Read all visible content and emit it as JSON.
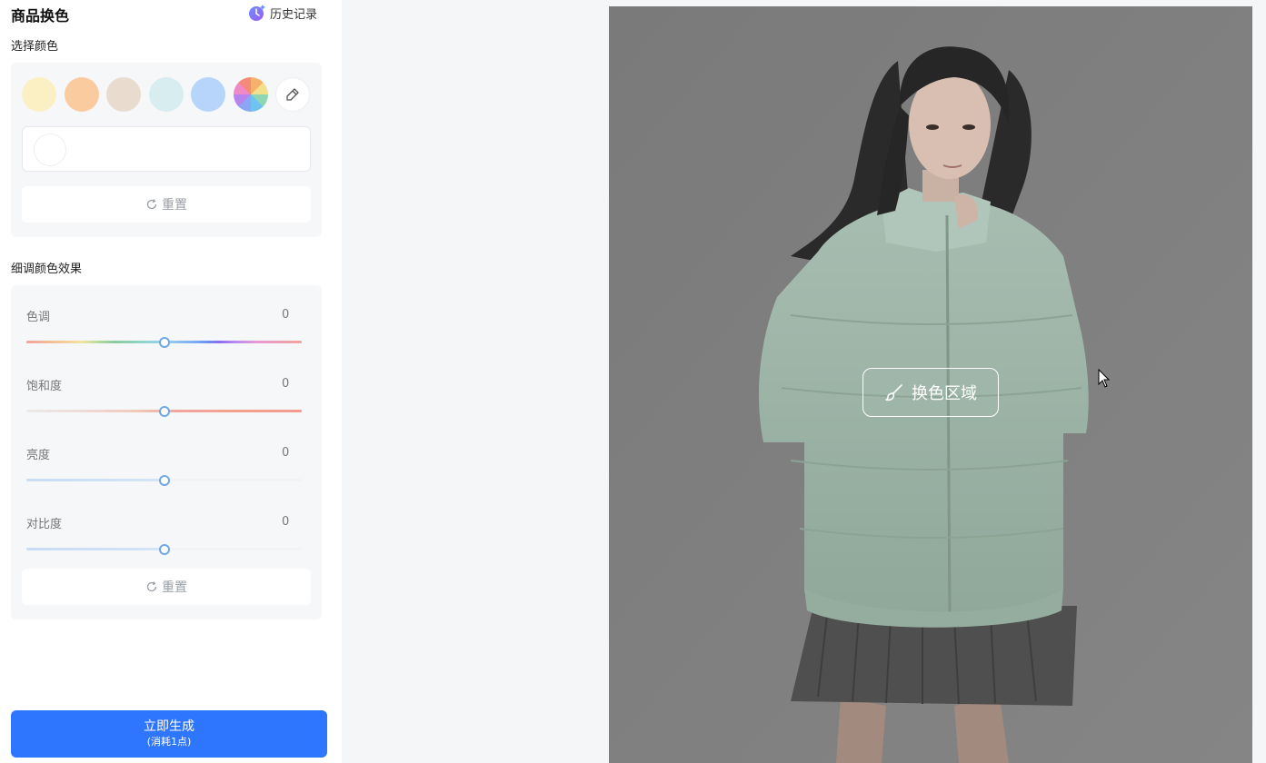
{
  "panel": {
    "title": "商品换色",
    "history_label": "历史记录",
    "select_color": {
      "title": "选择颜色",
      "swatches": [
        "#faf0c3",
        "#fbcba0",
        "#eadbcf",
        "#d8edf0",
        "#b7d5fa",
        "multicolor"
      ],
      "picker_icon": "eyedropper-icon",
      "reset_label": "重置"
    },
    "fine_tune": {
      "title": "细调颜色效果",
      "sliders": [
        {
          "label": "色调",
          "value": "0",
          "position": 0.5
        },
        {
          "label": "饱和度",
          "value": "0",
          "position": 0.5
        },
        {
          "label": "亮度",
          "value": "0",
          "position": 0.5
        },
        {
          "label": "对比度",
          "value": "0",
          "position": 0.5
        }
      ],
      "reset_label": "重置"
    },
    "generate": {
      "label": "立即生成",
      "cost": "(消耗1点)",
      "color": "#2f76ff"
    }
  },
  "preview": {
    "recolor_label": "换色区域",
    "recolor_icon": "brush-icon",
    "jacket_color": "#9fb7aa"
  }
}
